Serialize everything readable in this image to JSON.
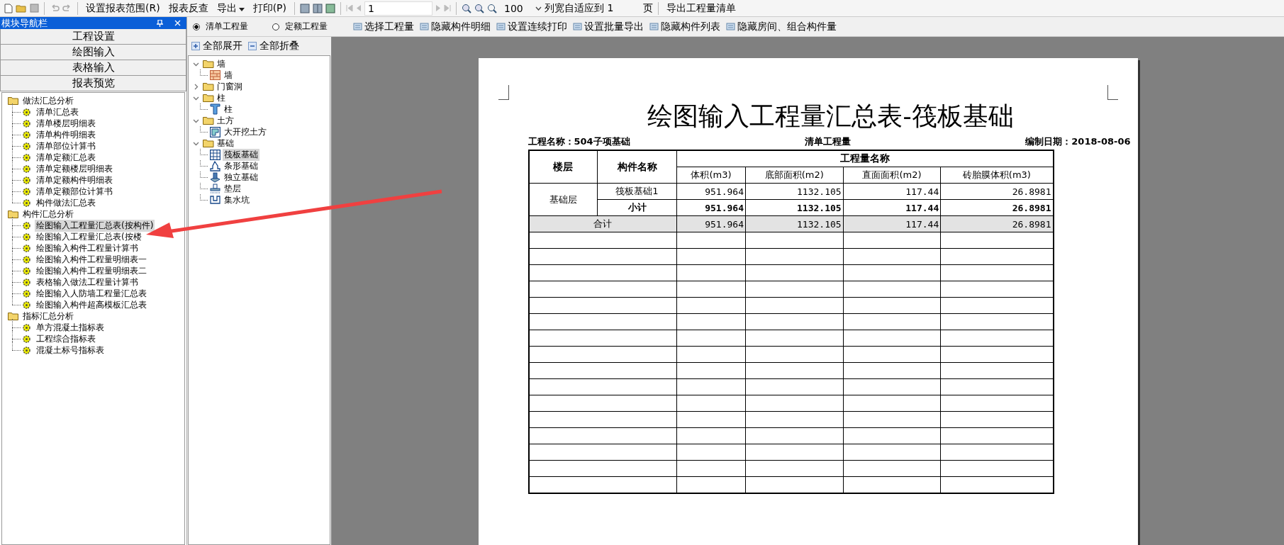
{
  "toolbar": {
    "report_range": "设置报表范围(R)",
    "reverse_lookup": "报表反查",
    "export": "导出",
    "print": "打印(P)",
    "page": "1",
    "zoom": "100",
    "fit_label": "列宽自适应到 1",
    "page_unit": "页",
    "export_list": "导出工程量清单"
  },
  "nav": {
    "title": "模块导航栏",
    "modules": [
      "工程设置",
      "绘图输入",
      "表格输入",
      "报表预览"
    ],
    "groups": [
      {
        "label": "做法汇总分析",
        "children": [
          {
            "label": "清单汇总表",
            "selected": false
          },
          {
            "label": "清单楼层明细表",
            "selected": false
          },
          {
            "label": "清单构件明细表",
            "selected": false
          },
          {
            "label": "清单部位计算书",
            "selected": false
          },
          {
            "label": "清单定额汇总表",
            "selected": false
          },
          {
            "label": "清单定额楼层明细表",
            "selected": false
          },
          {
            "label": "清单定额构件明细表",
            "selected": false
          },
          {
            "label": "清单定额部位计算书",
            "selected": false
          },
          {
            "label": "构件做法汇总表",
            "selected": false
          }
        ]
      },
      {
        "label": "构件汇总分析",
        "children": [
          {
            "label": "绘图输入工程量汇总表(按构件)",
            "selected": true
          },
          {
            "label": "绘图输入工程量汇总表(按楼",
            "selected": false
          },
          {
            "label": "绘图输入构件工程量计算书",
            "selected": false
          },
          {
            "label": "绘图输入构件工程量明细表一",
            "selected": false
          },
          {
            "label": "绘图输入构件工程量明细表二",
            "selected": false
          },
          {
            "label": "表格输入做法工程量计算书",
            "selected": false
          },
          {
            "label": "绘图输入人防墙工程量汇总表",
            "selected": false
          },
          {
            "label": "绘图输入构件超高模板汇总表",
            "selected": false
          }
        ]
      },
      {
        "label": "指标汇总分析",
        "children": [
          {
            "label": "单方混凝土指标表",
            "selected": false
          },
          {
            "label": "工程综合指标表",
            "selected": false
          },
          {
            "label": "混凝土标号指标表",
            "selected": false
          }
        ]
      }
    ]
  },
  "quantity_types": [
    {
      "label": "清单工程量",
      "selected": true
    },
    {
      "label": "定额工程量",
      "selected": false
    }
  ],
  "actions": [
    "选择工程量",
    "隐藏构件明细",
    "设置连续打印",
    "设置批量导出",
    "隐藏构件列表",
    "隐藏房间、组合构件量"
  ],
  "component_tree": {
    "expand_all": "全部展开",
    "collapse_all": "全部折叠",
    "nodes": [
      {
        "label": "墙",
        "expanded": true,
        "children": [
          {
            "label": "墙",
            "kind": "wall",
            "selected": false
          }
        ]
      },
      {
        "label": "门窗洞",
        "expanded": false
      },
      {
        "label": "柱",
        "expanded": true,
        "children": [
          {
            "label": "柱",
            "kind": "column",
            "selected": false
          }
        ]
      },
      {
        "label": "土方",
        "expanded": true,
        "children": [
          {
            "label": "大开挖土方",
            "kind": "excavation",
            "selected": false
          }
        ]
      },
      {
        "label": "基础",
        "expanded": true,
        "children": [
          {
            "label": "筏板基础",
            "kind": "raft",
            "selected": true
          },
          {
            "label": "条形基础",
            "kind": "strip",
            "selected": false
          },
          {
            "label": "独立基础",
            "kind": "isolated",
            "selected": false
          },
          {
            "label": "垫层",
            "kind": "cushion",
            "selected": false
          },
          {
            "label": "集水坑",
            "kind": "pit",
            "selected": false
          }
        ]
      }
    ]
  },
  "report": {
    "title": "绘图输入工程量汇总表-筏板基础",
    "project": "工程名称：504子项基础",
    "quantity_type": "清单工程量",
    "date": "编制日期：2018-08-06",
    "col_floor": "楼层",
    "col_component": "构件名称",
    "col_group": "工程量名称",
    "columns": [
      "体积(m3)",
      "底部面积(m2)",
      "直面面积(m2)",
      "砖胎膜体积(m3)"
    ],
    "floor": "基础层",
    "rows": [
      {
        "kind": "item",
        "name": "筏板基础1",
        "values": [
          "951.964",
          "1132.105",
          "117.44",
          "26.8981"
        ]
      },
      {
        "kind": "subtotal",
        "name": "小计",
        "values": [
          "951.964",
          "1132.105",
          "117.44",
          "26.8981"
        ]
      }
    ],
    "total": {
      "name": "合计",
      "values": [
        "951.964",
        "1132.105",
        "117.44",
        "26.8981"
      ]
    }
  }
}
